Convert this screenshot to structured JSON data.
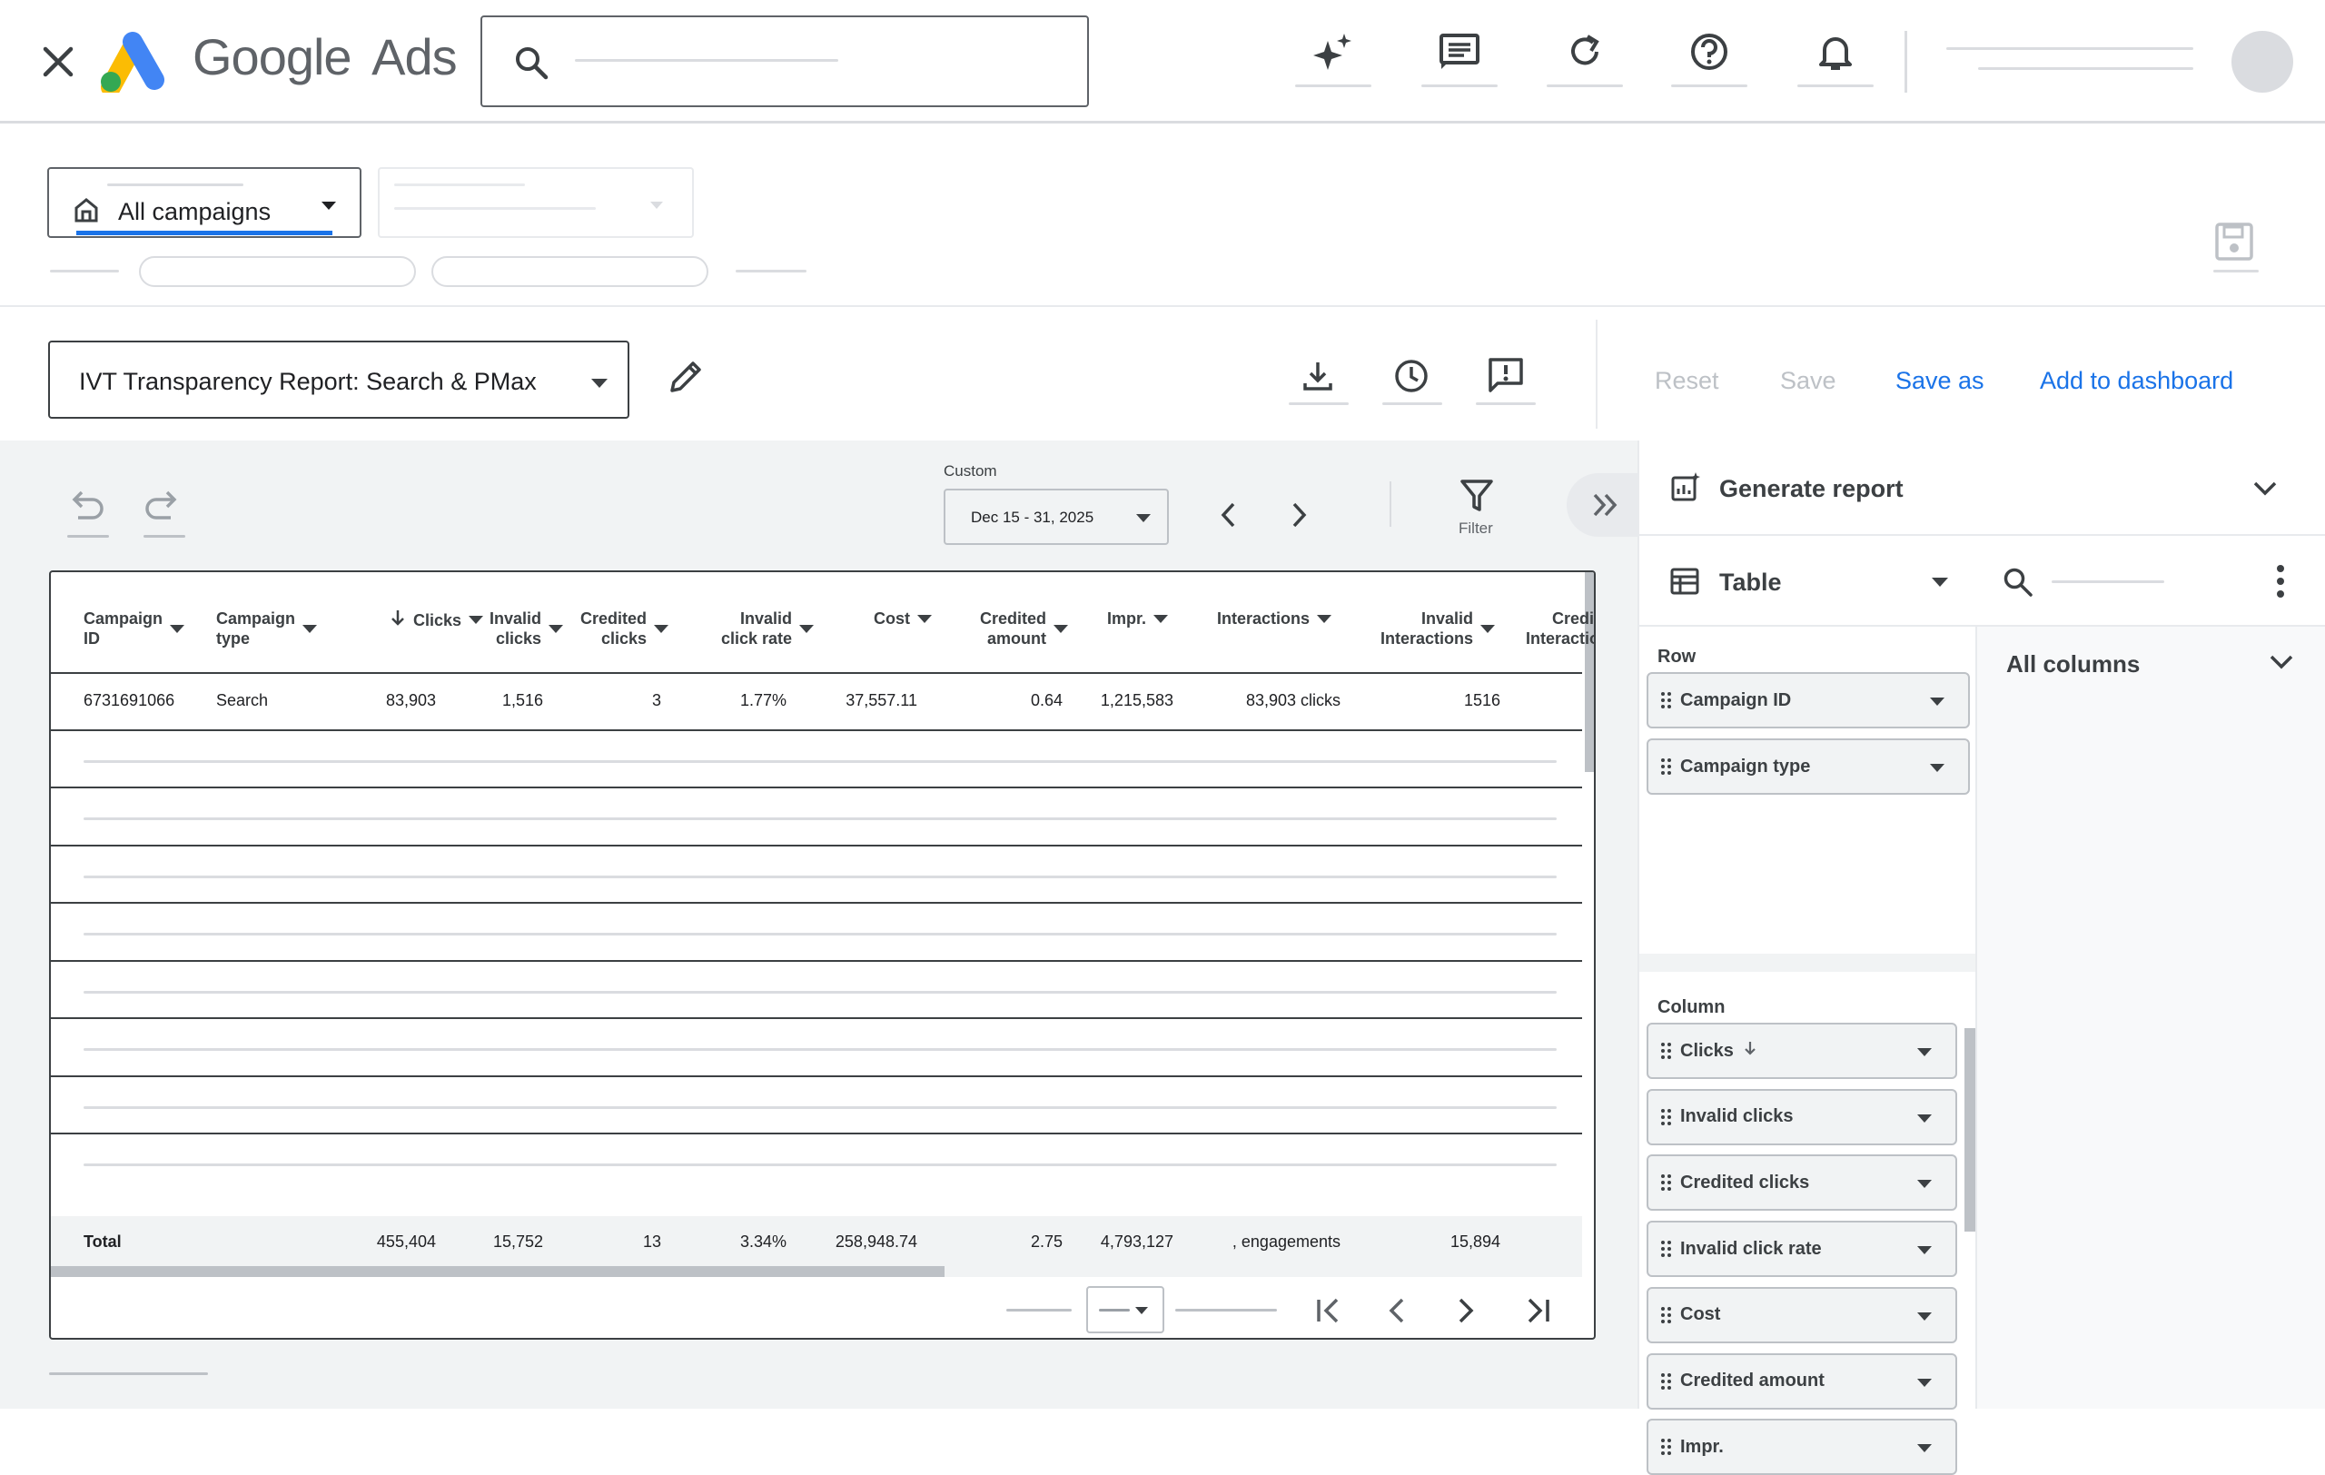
{
  "app": {
    "name_google": "Google",
    "name_ads": "Ads"
  },
  "topbar": {
    "icons": [
      "close-icon",
      "google-ads-logo",
      "search-icon",
      "sparkle-icon",
      "feedback-list-icon",
      "refresh-icon",
      "help-icon",
      "notifications-icon",
      "account-avatar"
    ]
  },
  "campaign_selector": {
    "label": "All campaigns"
  },
  "report": {
    "title": "IVT Transparency Report: Search & PMax",
    "actions": {
      "reset": "Reset",
      "save": "Save",
      "save_as": "Save as",
      "add_to_dashboard": "Add to dashboard"
    }
  },
  "toolbar": {
    "date_caption": "Custom",
    "date_range": "Dec 15 - 31, 2025",
    "filter_label": "Filter"
  },
  "table": {
    "columns": [
      {
        "line1": "Campaign",
        "line2": "ID"
      },
      {
        "line1": "Campaign",
        "line2": "type"
      },
      {
        "line1": "Clicks",
        "line2": ""
      },
      {
        "line1": "Invalid",
        "line2": "clicks"
      },
      {
        "line1": "Credited",
        "line2": "clicks"
      },
      {
        "line1": "Invalid",
        "line2": "click rate"
      },
      {
        "line1": "Cost",
        "line2": ""
      },
      {
        "line1": "Credited",
        "line2": "amount"
      },
      {
        "line1": "Impr.",
        "line2": ""
      },
      {
        "line1": "Interactions",
        "line2": ""
      },
      {
        "line1": "Invalid",
        "line2": "Interactions"
      },
      {
        "line1": "Credited",
        "line2": "Interactions"
      }
    ],
    "row": [
      "6731691066",
      "Search",
      "83,903",
      "1,516",
      "3",
      "1.77%",
      "37,557.11",
      "0.64",
      "1,215,583",
      "83,903 clicks",
      "1516"
    ],
    "total": [
      "Total",
      "",
      "455,404",
      "15,752",
      "13",
      "3.34%",
      "258,948.74",
      "2.75",
      "4,793,127",
      ", engagements",
      "15,894"
    ]
  },
  "panel": {
    "generate_report": "Generate report",
    "view_type": "Table",
    "row_section": "Row",
    "row_chips": [
      "Campaign ID",
      "Campaign type"
    ],
    "column_section": "Column",
    "column_chips": [
      "Clicks",
      "Invalid clicks",
      "Credited clicks",
      "Invalid click rate",
      "Cost",
      "Credited amount",
      "Impr."
    ],
    "all_columns": "All columns"
  },
  "colors": {
    "accent": "#1a73e8",
    "google_blue": "#4285f4",
    "google_yellow": "#fbbc04",
    "google_green": "#34a853"
  }
}
